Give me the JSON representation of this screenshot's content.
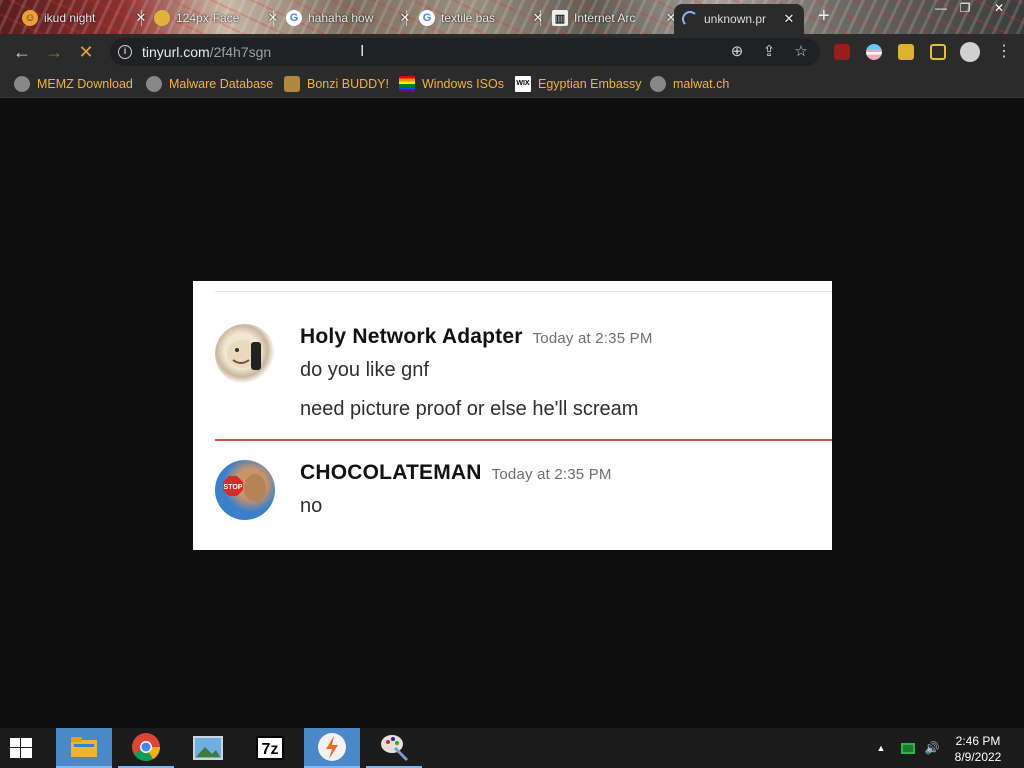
{
  "browser": {
    "tabs": [
      {
        "title": "ikud night",
        "close": "✕"
      },
      {
        "title": "124px-Face",
        "close": "✕"
      },
      {
        "title": "hahaha how",
        "close": "✕"
      },
      {
        "title": "textile bas",
        "close": "✕"
      },
      {
        "title": "Internet Arc",
        "close": "✕"
      },
      {
        "title": "unknown.pr",
        "close": "✕"
      }
    ],
    "new_tab": "+",
    "window_controls": {
      "minimize": "—",
      "restore": "❐",
      "close": "✕"
    },
    "nav": {
      "back": "←",
      "forward": "→",
      "stop": "✕"
    },
    "address": {
      "host": "tinyurl.com",
      "path": "/2f4h7sgn"
    },
    "omnibox_icons": {
      "zoom": "⊕",
      "share": "⇪",
      "star": "☆"
    },
    "menu": "⋮",
    "bookmarks": [
      {
        "label": "MEMZ Download"
      },
      {
        "label": "Malware Database"
      },
      {
        "label": "Bonzi BUDDY!"
      },
      {
        "label": "Windows ISOs"
      },
      {
        "label": "Egyptian Embassy"
      },
      {
        "label": "malwat.ch"
      }
    ]
  },
  "chat": {
    "messages": [
      {
        "username": "Holy Network Adapter",
        "timestamp": "Today at 2:35 PM",
        "lines": [
          "do you like gnf",
          "need picture proof or else he'll scream"
        ]
      },
      {
        "username": "CHOCOLATEMAN",
        "timestamp": "Today at 2:35 PM",
        "lines": [
          "no"
        ],
        "avatar_text": "STOP"
      }
    ]
  },
  "taskbar": {
    "tray_arrow": "▲",
    "volume": "🔊",
    "time": "2:46 PM",
    "date": "8/9/2022",
    "sevenzip_label": "7z"
  },
  "colors": {
    "bookmark_text": "#f2b24a",
    "divider": "#d24f4f",
    "taskbar_highlight": "#4a88c8"
  }
}
